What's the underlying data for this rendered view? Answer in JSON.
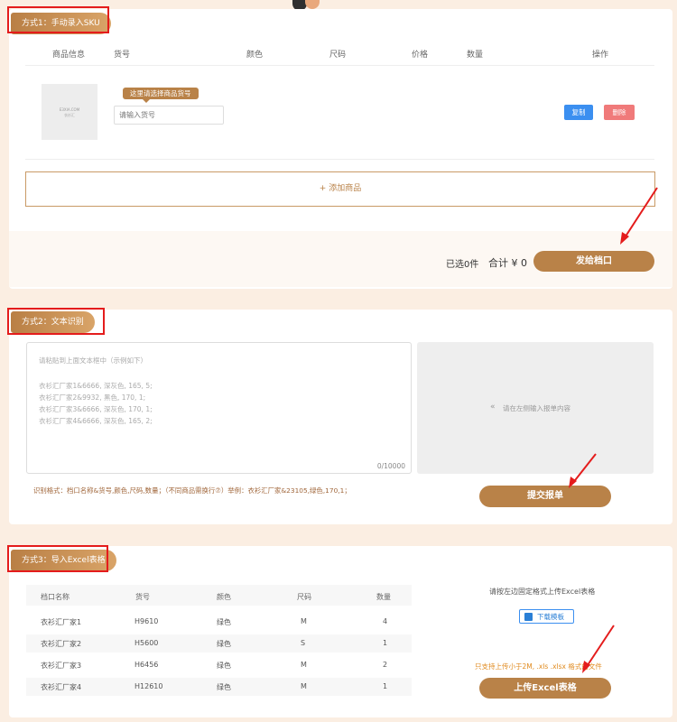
{
  "section1": {
    "tag": "方式1：手动录入SKU",
    "headers": [
      "商品信息",
      "货号",
      "颜色",
      "尺码",
      "价格",
      "数量",
      "操作"
    ],
    "product_image_text": [
      "E3XIA.COM",
      "衣衫汇"
    ],
    "tooltip": "这里请选择商品货号",
    "sku_placeholder": "请输入货号",
    "copy_label": "复制",
    "delete_label": "删除",
    "add_product_label": "+ 添加商品",
    "selected_text": "已选0件",
    "total_text": "合计 ¥ 0",
    "send_label": "发给档口"
  },
  "section2": {
    "tag": "方式2：文本识别",
    "textarea_placeholder_lines": [
      "请粘贴到上面文本框中（示例如下）",
      "",
      "衣衫汇厂家1&6666, 深灰色, 165, 5;",
      "衣衫汇厂家2&9932, 黑色, 170, 1;",
      "衣衫汇厂家3&6666, 深灰色, 170, 1;",
      "衣衫汇厂家4&6666, 深灰色, 165, 2;"
    ],
    "char_count": "0/10000",
    "preview_placeholder": "请在左侧输入报单内容",
    "format_hint": "识别格式：档口名称&货号,颜色,尺码,数量；（不同商品需换行⑦）举例：衣衫汇厂家&23105,绿色,170,1；",
    "submit_label": "提交报单"
  },
  "section3": {
    "tag": "方式3：导入Excel表格",
    "headers": [
      "档口名称",
      "货号",
      "颜色",
      "尺码",
      "数量"
    ],
    "rows": [
      [
        "衣衫汇厂家1",
        "H9610",
        "绿色",
        "M",
        "4"
      ],
      [
        "衣衫汇厂家2",
        "H5600",
        "绿色",
        "S",
        "1"
      ],
      [
        "衣衫汇厂家3",
        "H6456",
        "绿色",
        "M",
        "2"
      ],
      [
        "衣衫汇厂家4",
        "H12610",
        "绿色",
        "M",
        "1"
      ]
    ],
    "instruction": "请按左边固定格式上传Excel表格",
    "download_label": "下载模板",
    "file_note": "只支持上传小于2M, .xls .xlsx 格式的文件",
    "upload_label": "上传Excel表格"
  },
  "colors": {
    "accent": "#b98248",
    "annotation": "#e41c1c",
    "copy": "#3b8ff0",
    "delete": "#f07a7a"
  }
}
